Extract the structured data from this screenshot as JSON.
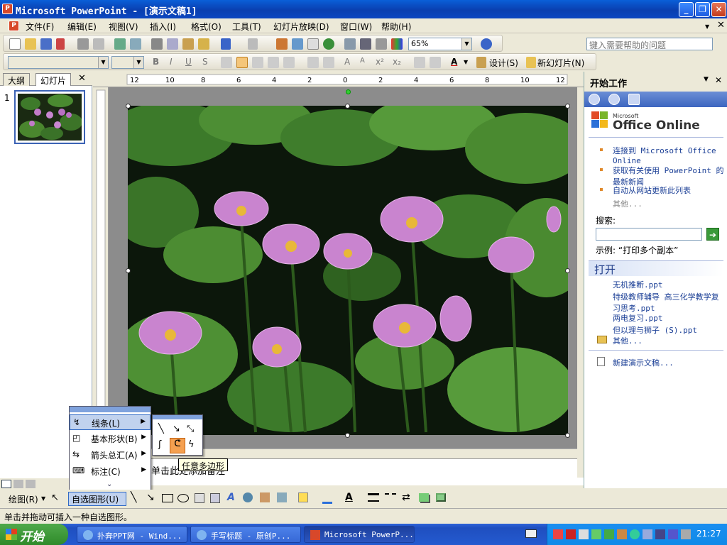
{
  "titlebar": {
    "title": "Microsoft PowerPoint - [演示文稿1]"
  },
  "menubar": {
    "items": [
      "文件(F)",
      "编辑(E)",
      "视图(V)",
      "插入(I)",
      "格式(O)",
      "工具(T)",
      "幻灯片放映(D)",
      "窗口(W)",
      "帮助(H)"
    ],
    "help_placeholder": "键入需要帮助的问题"
  },
  "toolbar": {
    "zoom": "65%",
    "design_label": "设计(S)",
    "new_slide_label": "新幻灯片(N)"
  },
  "left_pane": {
    "tab_outline": "大纲",
    "tab_slides": "幻灯片",
    "slide_number": "1"
  },
  "ruler": {
    "h_ticks": [
      "12",
      "10",
      "8",
      "6",
      "4",
      "2",
      "0",
      "2",
      "4",
      "6",
      "8",
      "10",
      "12"
    ]
  },
  "notes": {
    "placeholder": "单击此处添加备注"
  },
  "task_pane": {
    "title": "开始工作",
    "logo_small": "Microsoft",
    "logo_big": "Office Online",
    "links": [
      "连接到 Microsoft Office Online",
      "获取有关使用 PowerPoint 的最新新闻",
      "自动从网站更新此列表"
    ],
    "more": "其他...",
    "search_label": "搜索:",
    "example": "示例: “打印多个副本”",
    "open_header": "打开",
    "files": [
      "无机推断.ppt",
      "特级教师辅导 高三化学教学复习思考.ppt",
      "两电复习.ppt",
      "但以理与狮子 (S).ppt"
    ],
    "open_more": "其他...",
    "new_presentation": "新建演示文稿..."
  },
  "autoshape_menu": {
    "items": [
      {
        "label": "线条(L)",
        "icon": "lines-icon"
      },
      {
        "label": "基本形状(B)",
        "icon": "basic-shapes-icon"
      },
      {
        "label": "箭头总汇(A)",
        "icon": "block-arrows-icon"
      },
      {
        "label": "标注(C)",
        "icon": "callouts-icon"
      }
    ],
    "tooltip": "任意多边形"
  },
  "drawbar": {
    "draw_label": "绘图(R)",
    "autoshape_label": "自选图形(U)"
  },
  "status": {
    "text": "单击并拖动可插入一种自选图形。"
  },
  "taskbar": {
    "start": "开始",
    "tasks": [
      "扑奔PPT网 - Wind...",
      "手写标题 - 原创P...",
      "Microsoft PowerP..."
    ],
    "clock": "21:27"
  },
  "colors": {
    "xp_blue": "#0a5fd8",
    "start_green": "#3b9a35",
    "link_blue": "#1b3f96"
  }
}
